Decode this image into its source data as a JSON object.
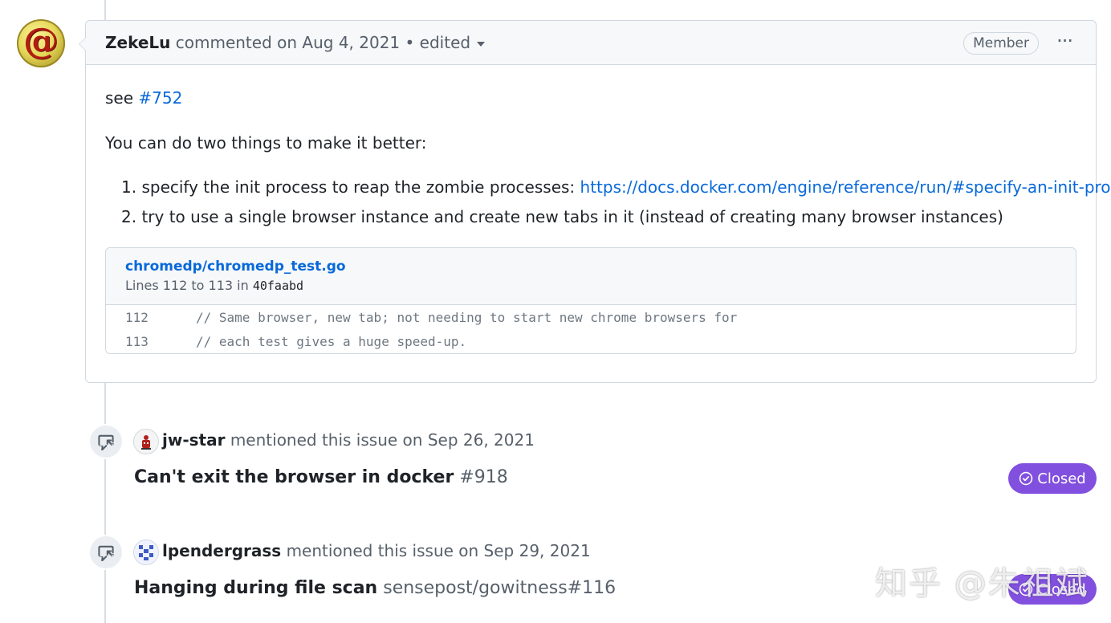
{
  "comment": {
    "author": "ZekeLu",
    "action": "commented on",
    "date": "Aug 4, 2021",
    "edited_label": "• edited",
    "role_badge": "Member",
    "menu_glyph": "···",
    "see_text": "see",
    "see_link": "#752",
    "intro": "You can do two things to make it better:",
    "list": [
      {
        "number": "1.",
        "text": "specify the init process to reap the zombie processes:",
        "link": "https://docs.docker.com/engine/reference/run/#specify-an-init-process"
      },
      {
        "number": "2.",
        "text": "try to use a single browser instance and create new tabs in it (instead of creating many browser instances)"
      }
    ],
    "code": {
      "file": "chromedp/chromedp_test.go",
      "lines_prefix": "Lines 112 to 113 in",
      "sha": "40faabd",
      "rows": [
        {
          "num": "112",
          "text": "// Same browser, new tab; not needing to start new chrome browsers for"
        },
        {
          "num": "113",
          "text": "// each test gives a huge speed-up."
        }
      ]
    }
  },
  "mentions": [
    {
      "author": "jw-star",
      "text": "mentioned this issue on Sep 26, 2021",
      "title": "Can't exit the browser in docker",
      "number": "#918",
      "status": "Closed"
    },
    {
      "author": "lpendergrass",
      "text": "mentioned this issue on Sep 29, 2021",
      "title": "Hanging during file scan",
      "number": "sensepost/gowitness#116",
      "status": "Closed"
    }
  ],
  "watermark": "知乎 @朱祖斌",
  "colors": {
    "closed": "#8250df",
    "link": "#0969da",
    "border": "#d0d7de"
  }
}
